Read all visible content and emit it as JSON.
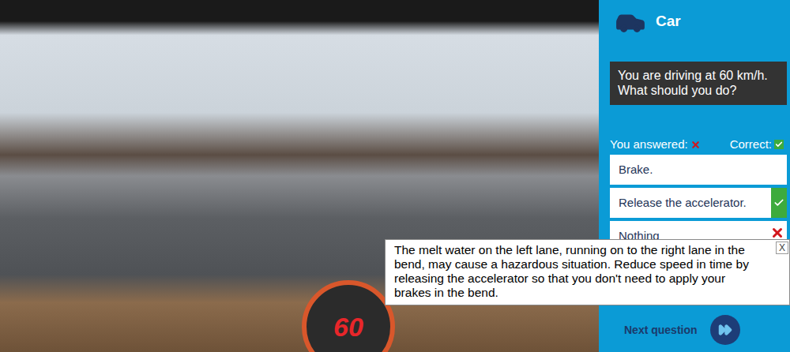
{
  "header": {
    "title": "Car"
  },
  "question": {
    "lines": [
      "You are driving at 60 km/h.",
      "What should you do?"
    ]
  },
  "legend": {
    "answered_label": "You answered:",
    "correct_label": "Correct:"
  },
  "options": [
    {
      "label": "Brake.",
      "answered": false,
      "correct": false
    },
    {
      "label": "Release the accelerator.",
      "answered": false,
      "correct": true
    },
    {
      "label": "Nothing",
      "answered": true,
      "correct": false
    }
  ],
  "speedometer": {
    "reading": "60"
  },
  "tooltip": {
    "lines": [
      "The melt water on the left lane, running on to the right lane in the",
      "bend, may cause a hazardous situation. Reduce speed in time by",
      "releasing the accelerator so that you don't need to apply your",
      "brakes in the bend."
    ],
    "close": "X"
  },
  "next": {
    "label": "Next question"
  }
}
